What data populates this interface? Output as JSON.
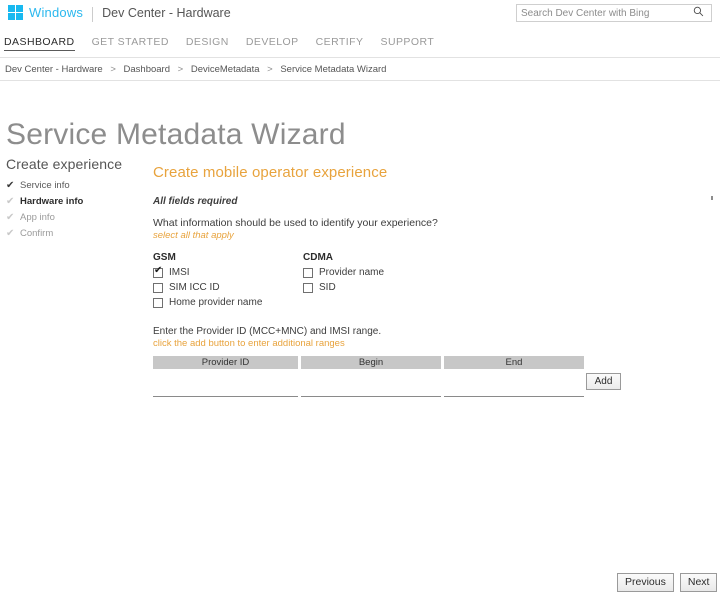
{
  "header": {
    "brand_name": "Windows",
    "brand_sub": "Dev Center - Hardware",
    "search": {
      "placeholder": "Search Dev Center with Bing",
      "value": "",
      "icon": "search-icon"
    }
  },
  "primary_nav": {
    "items": [
      {
        "label": "DASHBOARD",
        "active": true
      },
      {
        "label": "GET STARTED",
        "active": false
      },
      {
        "label": "DESIGN",
        "active": false
      },
      {
        "label": "DEVELOP",
        "active": false
      },
      {
        "label": "CERTIFY",
        "active": false
      },
      {
        "label": "SUPPORT",
        "active": false
      }
    ]
  },
  "breadcrumb": {
    "separator": ">",
    "items": [
      "Dev Center - Hardware",
      "Dashboard",
      "DeviceMetadata",
      "Service Metadata Wizard"
    ]
  },
  "page_title": "Service Metadata Wizard",
  "sidebar": {
    "title": "Create experience",
    "check_glyph": "✔",
    "items": [
      {
        "label": "Service info",
        "state": "done"
      },
      {
        "label": "Hardware info",
        "state": "current"
      },
      {
        "label": "App info",
        "state": "todo"
      },
      {
        "label": "Confirm",
        "state": "todo"
      }
    ]
  },
  "main": {
    "section_heading": "Create mobile operator experience",
    "required_note": "All fields required",
    "question": "What information should be used to identify your experience?",
    "question_hint": "select all that apply",
    "groups": [
      {
        "label": "GSM",
        "options": [
          {
            "label": "IMSI",
            "checked": true
          },
          {
            "label": "SIM ICC ID",
            "checked": false
          },
          {
            "label": "Home provider name",
            "checked": false
          }
        ]
      },
      {
        "label": "CDMA",
        "options": [
          {
            "label": "Provider name",
            "checked": false
          },
          {
            "label": "SID",
            "checked": false
          }
        ]
      }
    ],
    "range_prompt": "Enter the Provider ID (MCC+MNC) and IMSI range.",
    "range_hint": "click the add button to enter additional ranges",
    "table": {
      "columns": [
        "Provider ID",
        "Begin",
        "End"
      ],
      "rows": [
        {
          "provider_id": "",
          "begin": "",
          "end": ""
        }
      ]
    },
    "add_button": "Add"
  },
  "footer": {
    "previous_label": "Previous",
    "next_label": "Next"
  },
  "colors": {
    "accent_orange": "#e8a33d",
    "brand_blue": "#2bb8ee",
    "windows_logo": "#18b9f0",
    "table_header_gray": "#c7c7c7",
    "title_gray": "#8d8d8d"
  }
}
